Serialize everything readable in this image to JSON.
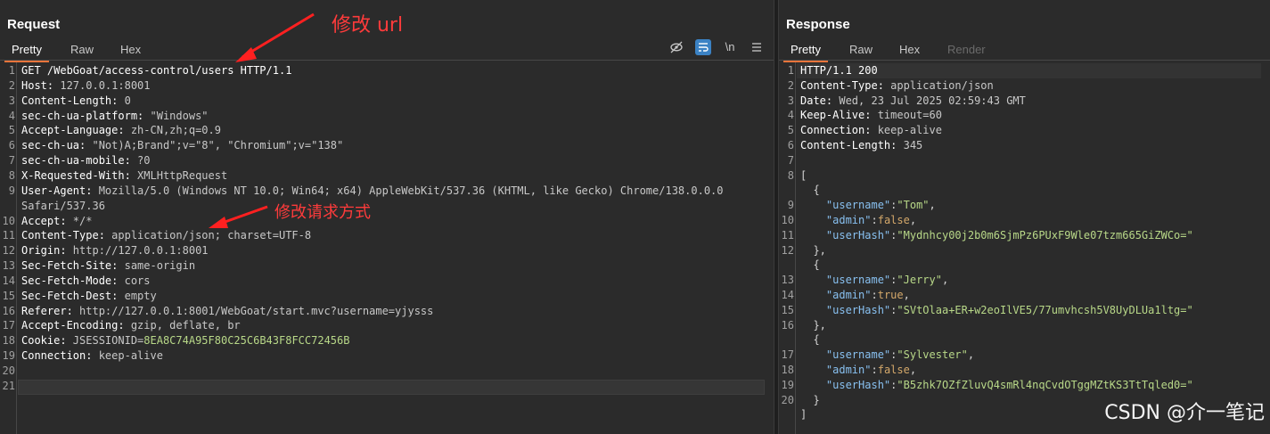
{
  "request": {
    "title": "Request",
    "tabs": [
      "Pretty",
      "Raw",
      "Hex"
    ],
    "toolbar": {
      "newline_label": "\\n"
    },
    "lines": [
      {
        "n": "1",
        "k": "GET /WebGoat/access-control/users HTTP/1.1",
        "v": ""
      },
      {
        "n": "2",
        "k": "Host:",
        "v": " 127.0.0.1:8001"
      },
      {
        "n": "3",
        "k": "Content-Length:",
        "v": " 0"
      },
      {
        "n": "4",
        "k": "sec-ch-ua-platform:",
        "v": " \"Windows\""
      },
      {
        "n": "5",
        "k": "Accept-Language:",
        "v": " zh-CN,zh;q=0.9"
      },
      {
        "n": "6",
        "k": "sec-ch-ua:",
        "v": " \"Not)A;Brand\";v=\"8\", \"Chromium\";v=\"138\""
      },
      {
        "n": "7",
        "k": "sec-ch-ua-mobile:",
        "v": " ?0"
      },
      {
        "n": "8",
        "k": "X-Requested-With:",
        "v": " XMLHttpRequest"
      },
      {
        "n": "9",
        "k": "User-Agent:",
        "v": " Mozilla/5.0 (Windows NT 10.0; Win64; x64) AppleWebKit/537.36 (KHTML, like Gecko) Chrome/138.0.0.0"
      },
      {
        "n": "",
        "k": "",
        "v": "Safari/537.36"
      },
      {
        "n": "10",
        "k": "Accept:",
        "v": " */*"
      },
      {
        "n": "11",
        "k": "Content-Type:",
        "v": " application/json; charset=UTF-8"
      },
      {
        "n": "12",
        "k": "Origin:",
        "v": " http://127.0.0.1:8001"
      },
      {
        "n": "13",
        "k": "Sec-Fetch-Site:",
        "v": " same-origin"
      },
      {
        "n": "14",
        "k": "Sec-Fetch-Mode:",
        "v": " cors"
      },
      {
        "n": "15",
        "k": "Sec-Fetch-Dest:",
        "v": " empty"
      },
      {
        "n": "16",
        "k": "Referer:",
        "v": " http://127.0.0.1:8001/WebGoat/start.mvc?username=yjysss"
      },
      {
        "n": "17",
        "k": "Accept-Encoding:",
        "v": " gzip, deflate, br"
      },
      {
        "n": "18",
        "k": "Cookie:",
        "v": " JSESSIONID=",
        "g": "8EA8C74A95F80C25C6B43F8FCC72456B"
      },
      {
        "n": "19",
        "k": "Connection:",
        "v": " keep-alive"
      },
      {
        "n": "20",
        "k": "",
        "v": ""
      },
      {
        "n": "21",
        "k": "",
        "v": ""
      }
    ]
  },
  "response": {
    "title": "Response",
    "tabs": [
      "Pretty",
      "Raw",
      "Hex",
      "Render"
    ],
    "lines": [
      {
        "n": "1",
        "k": "HTTP/1.1 200",
        "v": ""
      },
      {
        "n": "2",
        "k": "Content-Type:",
        "v": " application/json"
      },
      {
        "n": "3",
        "k": "Date:",
        "v": " Wed, 23 Jul 2025 02:59:43 GMT"
      },
      {
        "n": "4",
        "k": "Keep-Alive:",
        "v": " timeout=60"
      },
      {
        "n": "5",
        "k": "Connection:",
        "v": " keep-alive"
      },
      {
        "n": "6",
        "k": "Content-Length:",
        "v": " 345"
      },
      {
        "n": "7",
        "k": "",
        "v": ""
      },
      {
        "n": "8",
        "p": "["
      },
      {
        "n": "",
        "p": "  {"
      },
      {
        "n": "9",
        "jk": "    \"username\"",
        "sep": ":",
        "js": "\"Tom\"",
        "end": ","
      },
      {
        "n": "10",
        "jk": "    \"admin\"",
        "sep": ":",
        "jl": "false",
        "end": ","
      },
      {
        "n": "11",
        "jk": "    \"userHash\"",
        "sep": ":",
        "js": "\"Mydnhcy00j2b0m6SjmPz6PUxF9Wle07tzm665GiZWCo=\"",
        "end": ""
      },
      {
        "n": "12",
        "p": "  },"
      },
      {
        "n": "",
        "p": "  {"
      },
      {
        "n": "13",
        "jk": "    \"username\"",
        "sep": ":",
        "js": "\"Jerry\"",
        "end": ","
      },
      {
        "n": "14",
        "jk": "    \"admin\"",
        "sep": ":",
        "jl": "true",
        "end": ","
      },
      {
        "n": "15",
        "jk": "    \"userHash\"",
        "sep": ":",
        "js": "\"SVtOlaa+ER+w2eoIlVE5/77umvhcsh5V8UyDLUa1ltg=\"",
        "end": ""
      },
      {
        "n": "16",
        "p": "  },"
      },
      {
        "n": "",
        "p": "  {"
      },
      {
        "n": "17",
        "jk": "    \"username\"",
        "sep": ":",
        "js": "\"Sylvester\"",
        "end": ","
      },
      {
        "n": "18",
        "jk": "    \"admin\"",
        "sep": ":",
        "jl": "false",
        "end": ","
      },
      {
        "n": "19",
        "jk": "    \"userHash\"",
        "sep": ":",
        "js": "\"B5zhk7OZfZluvQ4smRl4nqCvdOTggMZtKS3TtTqled0=\"",
        "end": ""
      },
      {
        "n": "20",
        "p": "  }"
      },
      {
        "n": "",
        "p": "]"
      }
    ]
  },
  "annotations": {
    "url_note": "修改 url",
    "method_note": "修改请求方式"
  },
  "watermark": "CSDN @介一笔记",
  "colors": {
    "accent": "#e8743b",
    "annotation": "#ff3b3b",
    "active_toggle": "#3b82c4"
  }
}
